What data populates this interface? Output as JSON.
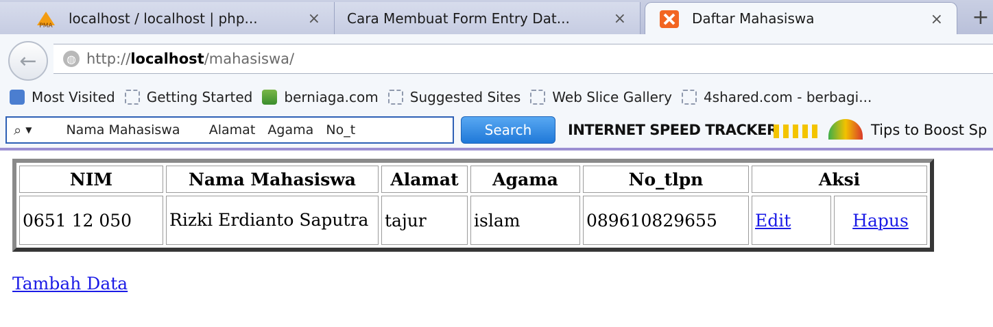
{
  "tabs": [
    {
      "title": "localhost / localhost | php...",
      "close": "×",
      "state": "inactive"
    },
    {
      "title": "Cara Membuat Form Entry Dat...",
      "close": "×",
      "state": "inactive"
    },
    {
      "title": "Daftar Mahasiswa",
      "close": "×",
      "state": "active"
    }
  ],
  "new_tab": "+",
  "favicon_pma_text": "PMA",
  "nav": {
    "back": "←",
    "url_prefix": "http://",
    "url_host": "localhost",
    "url_path": "/mahasiswa/"
  },
  "bookmarks": [
    "Most Visited",
    "Getting Started",
    "berniaga.com",
    "Suggested Sites",
    "Web Slice Gallery",
    "4shared.com - berbagi..."
  ],
  "toolbar": {
    "search_value": "Nama Mahasiswa       Alamat   Agama   No_t",
    "search_button": "Search",
    "tracker_label": "INTERNET SPEED TRACKER",
    "tips_label": "Tips to Boost Sp"
  },
  "table": {
    "headers": [
      "NIM",
      "Nama Mahasiswa",
      "Alamat",
      "Agama",
      "No_tlpn",
      "Aksi"
    ],
    "rows": [
      {
        "nim": "0651 12 050",
        "nama": "Rizki Erdianto Saputra",
        "alamat": "tajur",
        "agama": "islam",
        "no_tlpn": "089610829655",
        "edit": "Edit",
        "hapus": "Hapus"
      }
    ]
  },
  "tambah_data": "Tambah Data",
  "colors": {
    "link": "#1a1ae6",
    "search_button": "#1f78d8",
    "toolbar_border": "#9b8fd2"
  }
}
